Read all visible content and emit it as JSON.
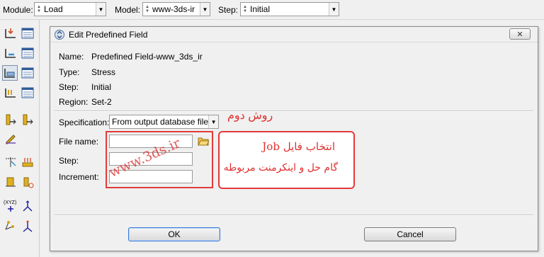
{
  "topbar": {
    "module_label": "Module:",
    "module_value": "Load",
    "model_label": "Model:",
    "model_value": "www-3ds-ir",
    "step_label": "Step:",
    "step_value": "Initial"
  },
  "dialog": {
    "title": "Edit Predefined Field",
    "info": {
      "name_key": "Name:",
      "name_val": "Predefined Field-www_3ds_ir",
      "type_key": "Type:",
      "type_val": "Stress",
      "step_key": "Step:",
      "step_val": "Initial",
      "region_key": "Region:",
      "region_val": "Set-2"
    },
    "fields": {
      "specification_label": "Specification:",
      "specification_value": "From output database file",
      "file_name_label": "File name:",
      "file_name_value": "",
      "step_label": "Step:",
      "step_value": "",
      "increment_label": "Increment:",
      "increment_value": ""
    },
    "ok_label": "OK",
    "cancel_label": "Cancel"
  },
  "annotations": {
    "watermark": "www.3ds.ir",
    "method_title": "روش دوم",
    "note_line1": "انتخاب فایل Job",
    "note_line2": "گام حل و اینکرمنت مربوطه",
    "accent_color": "#e03030"
  },
  "icons": {
    "toolbox": [
      "load-manager-icon",
      "load-list-icon",
      "bc-icon",
      "bc-list-icon",
      "predefined-field-icon",
      "predefined-field-list-icon",
      "load-case-icon",
      "load-case-list-icon",
      "analytical-field-icon",
      "discrete-field-icon",
      "edit-tool-icon",
      "query-icon",
      "surface-load-icon",
      "amplitude-icon",
      "datum-csys-icon",
      "datum-point-icon",
      "partition-icon",
      "datum-plane-icon"
    ]
  }
}
